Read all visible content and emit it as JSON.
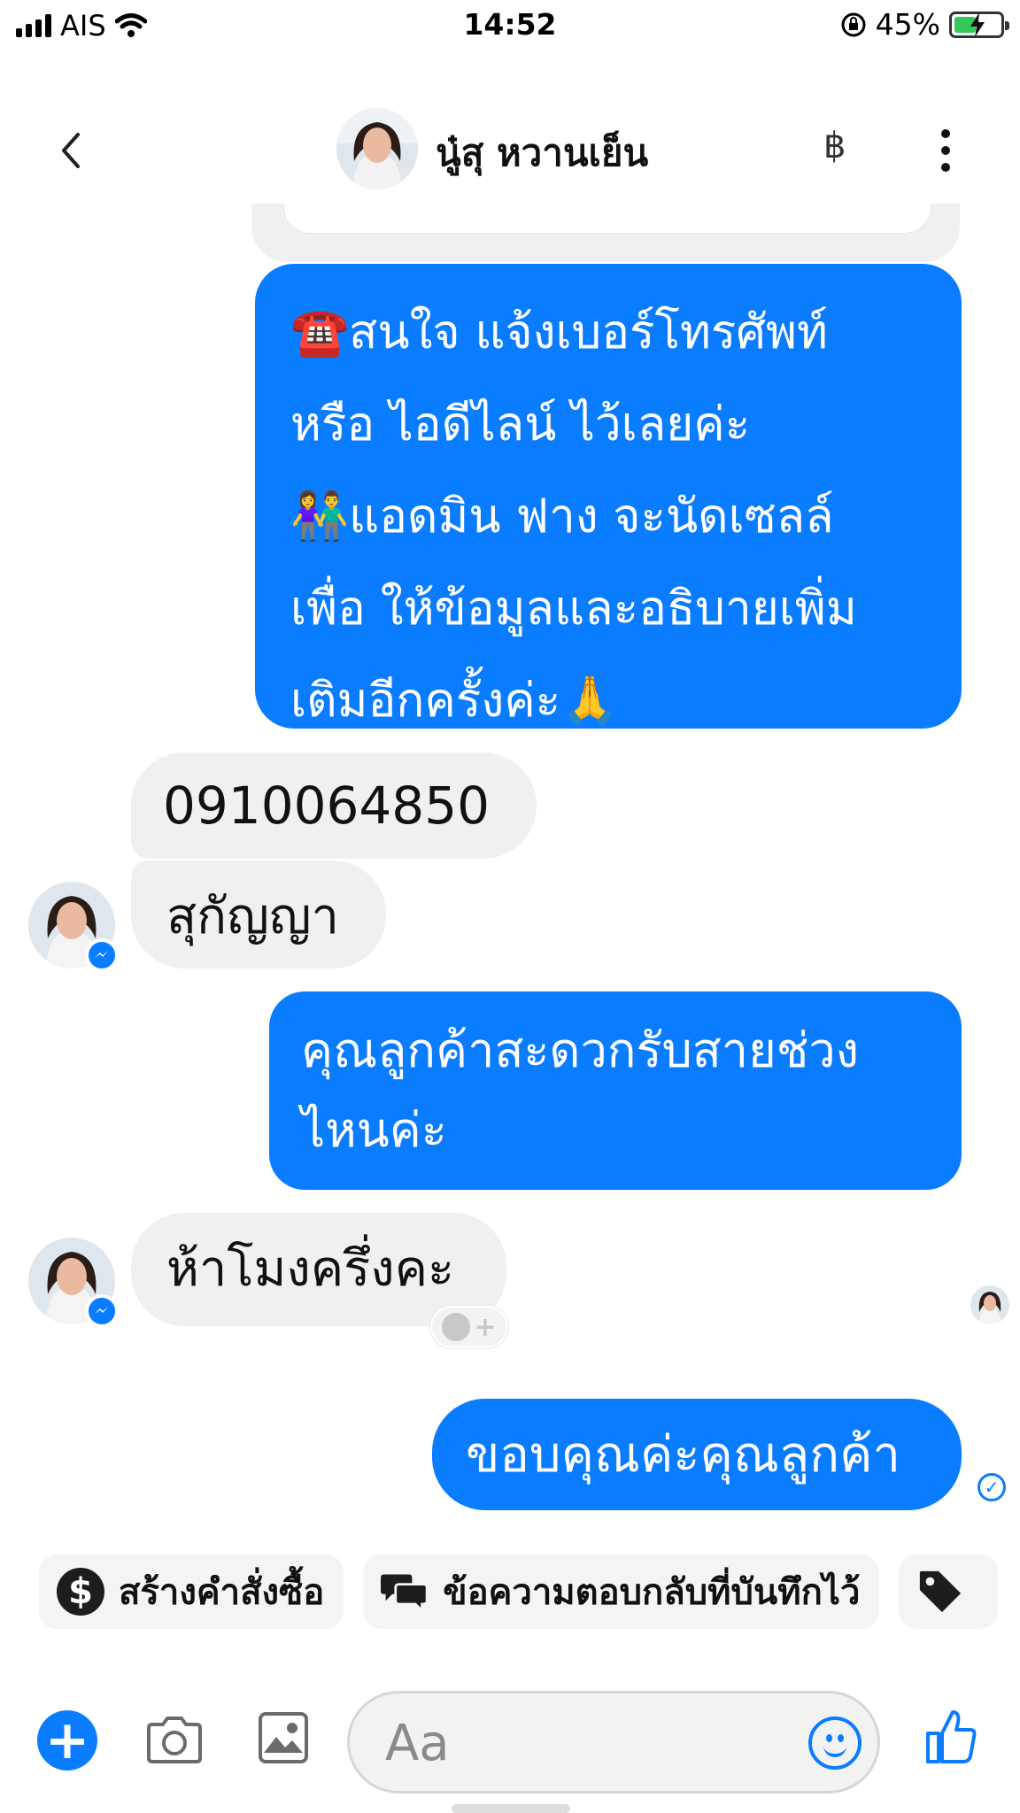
{
  "status_bar": {
    "carrier": "AIS",
    "time": "14:52",
    "battery_percent": "45%"
  },
  "header": {
    "contact_name": "นู๋สุ หวานเย็น",
    "baht_symbol": "฿"
  },
  "messages": [
    {
      "direction": "outgoing",
      "text": "☎️สนใจ แจ้งเบอร์โทรศัพท์\nหรือ ไอดีไลน์  ไว้เลยค่ะ\n👫แอดมิน ฟาง จะนัดเซลล์\nเพื่อ ให้ข้อมูลและอธิบายเพิ่ม\nเติมอีกครั้งค่ะ🙏"
    },
    {
      "direction": "incoming",
      "text": "0910064850"
    },
    {
      "direction": "incoming",
      "text": "สุกัญญา"
    },
    {
      "direction": "outgoing",
      "text": "คุณลูกค้าสะดวกรับสายช่วง\nไหนค่ะ"
    },
    {
      "direction": "incoming",
      "text": "ห้าโมงครึ่งคะ"
    },
    {
      "direction": "outgoing",
      "text": "ขอบคุณค่ะคุณลูกค้า"
    }
  ],
  "quick_replies": [
    {
      "label": "สร้างคำสั่งซื้อ",
      "icon": "dollar-icon"
    },
    {
      "label": "ข้อความตอบกลับที่บันทึกไว้",
      "icon": "chat-bubbles-icon"
    },
    {
      "label": "",
      "icon": "tag-icon"
    }
  ],
  "composer": {
    "placeholder": "Aa"
  },
  "colors": {
    "accent": "#0a7cff",
    "incoming_bubble": "#f0f0f0",
    "chip_bg": "#f4f4f4"
  }
}
